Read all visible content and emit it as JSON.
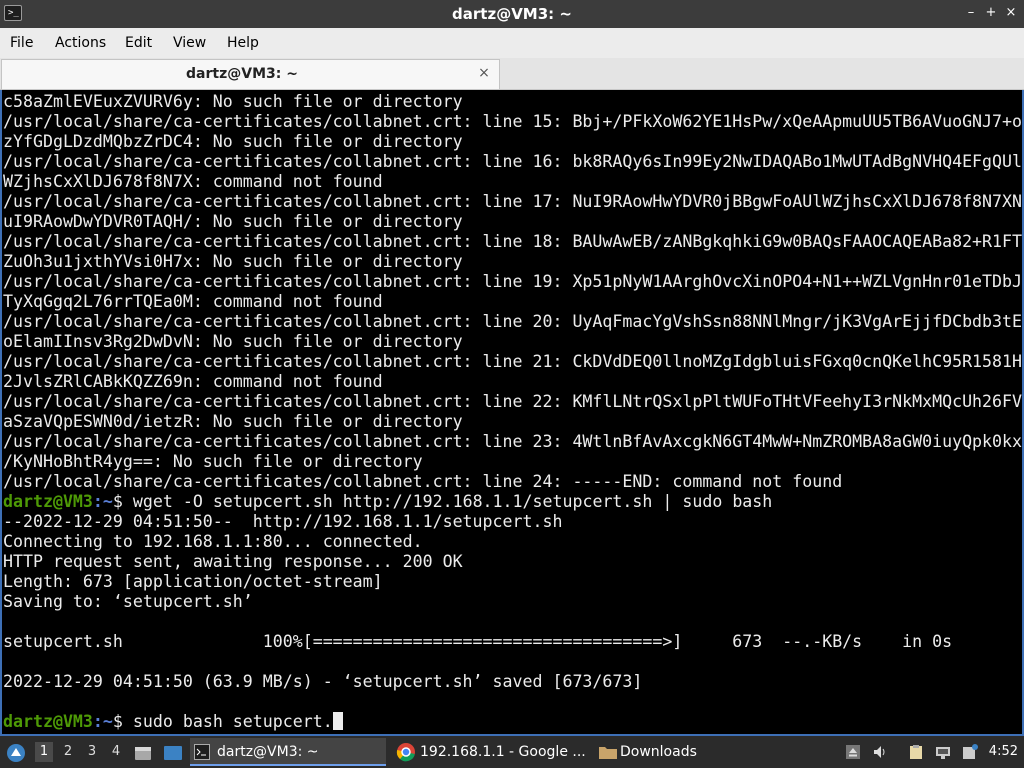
{
  "window": {
    "title": "dartz@VM3: ~",
    "app_icon_glyph": ">_",
    "controls": {
      "minimize": "–",
      "maximize": "+",
      "close": "×"
    }
  },
  "menu": [
    "File",
    "Actions",
    "Edit",
    "View",
    "Help"
  ],
  "tab": {
    "label": "dartz@VM3: ~",
    "close": "×"
  },
  "terminal": {
    "prompt_user": "dartz@VM3",
    "prompt_path": ":~",
    "prompt_symbol": "$",
    "lines": [
      "c58aZmlEVEuxZVURV6y: No such file or directory",
      "/usr/local/share/ca-certificates/collabnet.crt: line 15: Bbj+/PFkXoW62YE1HsPw/xQeAApmuUU5TB6AVuoGNJ7+o",
      "zYfGDgLDzdMQbzZrDC4: No such file or directory",
      "/usr/local/share/ca-certificates/collabnet.crt: line 16: bk8RAQy6sIn99Ey2NwIDAQABo1MwUTAdBgNVHQ4EFgQUl",
      "WZjhsCxXlDJ678f8N7X: command not found",
      "/usr/local/share/ca-certificates/collabnet.crt: line 17: NuI9RAowHwYDVR0jBBgwFoAUlWZjhsCxXlDJ678f8N7XN",
      "uI9RAowDwYDVR0TAQH/: No such file or directory",
      "/usr/local/share/ca-certificates/collabnet.crt: line 18: BAUwAwEB/zANBgkqhkiG9w0BAQsFAAOCAQEABa82+R1FT",
      "ZuOh3u1jxthYVsi0H7x: No such file or directory",
      "/usr/local/share/ca-certificates/collabnet.crt: line 19: Xp51pNyW1AArghOvcXinOPO4+N1++WZLVgnHnr01eTDbJ",
      "TyXqGgq2L76rrTQEa0M: command not found",
      "/usr/local/share/ca-certificates/collabnet.crt: line 20: UyAqFmacYgVshSsn88NNlMngr/jK3VgArEjjfDCbdb3tE",
      "oElamIInsv3Rg2DwDvN: No such file or directory",
      "/usr/local/share/ca-certificates/collabnet.crt: line 21: CkDVdDEQ0llnoMZgIdgbluisFGxq0cnQKelhC95R1581H",
      "2JvlsZRlCABkKQZZ69n: command not found",
      "/usr/local/share/ca-certificates/collabnet.crt: line 22: KMflLNtrQSxlpPltWUFoTHtVFeehyI3rNkMxMQcUh26FV",
      "aSzaVQpESWN0d/ietzR: No such file or directory",
      "/usr/local/share/ca-certificates/collabnet.crt: line 23: 4WtlnBfAvAxcgkN6GT4MwW+NmZROMBA8aGW0iuyQpk0kx",
      "/KyNHoBhtR4yg==: No such file or directory",
      "/usr/local/share/ca-certificates/collabnet.crt: line 24: -----END: command not found"
    ],
    "command1": " wget -O setupcert.sh http://192.168.1.1/setupcert.sh | sudo bash",
    "output": [
      "--2022-12-29 04:51:50--  http://192.168.1.1/setupcert.sh",
      "Connecting to 192.168.1.1:80... connected.",
      "HTTP request sent, awaiting response... 200 OK",
      "Length: 673 [application/octet-stream]",
      "Saving to: ‘setupcert.sh’",
      "",
      "setupcert.sh              100%[===================================>]     673  --.-KB/s    in 0s",
      "",
      "2022-12-29 04:51:50 (63.9 MB/s) - ‘setupcert.sh’ saved [673/673]",
      ""
    ],
    "command2": " sudo bash setupcert."
  },
  "taskbar": {
    "workspaces": [
      "1",
      "2",
      "3",
      "4"
    ],
    "active_workspace": "1",
    "tasks": [
      {
        "label": "dartz@VM3: ~",
        "icon": "terminal-icon"
      },
      {
        "label": "192.168.1.1 - Google ...",
        "icon": "chrome-icon"
      },
      {
        "label": "Downloads",
        "icon": "folder-icon"
      }
    ],
    "clock": "4:52"
  },
  "colors": {
    "prompt_user": "#4e9a06",
    "prompt_path": "#5a7fd6",
    "terminal_bg": "#000000",
    "terminal_fg": "#ececec",
    "titlebar": "#3c3c3c",
    "taskbar": "#2b2b2b"
  }
}
